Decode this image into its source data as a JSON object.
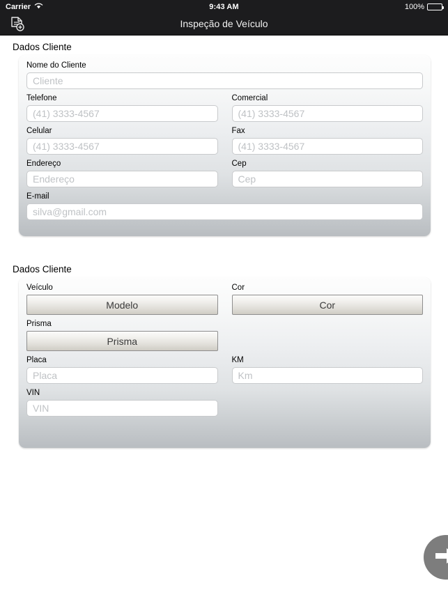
{
  "status_bar": {
    "carrier": "Carrier",
    "wifi_icon": "wifi-icon",
    "time": "9:43 AM",
    "battery_percent": "100%",
    "battery_icon": "battery-full-icon"
  },
  "nav_bar": {
    "title": "Inspeção de Veículo",
    "left_button_icon": "document-add-icon"
  },
  "sections": [
    {
      "title": "Dados Cliente",
      "rows": [
        [
          {
            "label": "Nome do Cliente",
            "placeholder": "Cliente",
            "value": "",
            "type": "text",
            "width": "full",
            "name": "client-name"
          }
        ],
        [
          {
            "label": "Telefone",
            "placeholder": "(41) 3333-4567",
            "value": "",
            "type": "text",
            "width": "half",
            "name": "phone"
          },
          {
            "label": "Comercial",
            "placeholder": "(41) 3333-4567",
            "value": "",
            "type": "text",
            "width": "half",
            "name": "commercial-phone"
          }
        ],
        [
          {
            "label": "Celular",
            "placeholder": "(41) 3333-4567",
            "value": "",
            "type": "text",
            "width": "half",
            "name": "mobile-phone"
          },
          {
            "label": "Fax",
            "placeholder": "(41) 3333-4567",
            "value": "",
            "type": "text",
            "width": "half",
            "name": "fax"
          }
        ],
        [
          {
            "label": "Endereço",
            "placeholder": "Endereço",
            "value": "",
            "type": "text",
            "width": "half",
            "name": "address"
          },
          {
            "label": "Cep",
            "placeholder": "Cep",
            "value": "",
            "type": "text",
            "width": "half",
            "name": "postal-code"
          }
        ],
        [
          {
            "label": "E-mail",
            "placeholder": "silva@gmail.com",
            "value": "",
            "type": "text",
            "width": "full",
            "name": "email"
          }
        ]
      ]
    },
    {
      "title": "Dados Cliente",
      "rows": [
        [
          {
            "label": "Veículo",
            "button_label": "Modelo",
            "type": "button",
            "width": "half",
            "name": "vehicle-model"
          },
          {
            "label": "Cor",
            "button_label": "Cor",
            "type": "button",
            "width": "half",
            "name": "vehicle-color"
          }
        ],
        [
          {
            "label": "Prisma",
            "button_label": "Prisma",
            "type": "button",
            "width": "half",
            "name": "vehicle-prisma"
          },
          {
            "label": "",
            "type": "empty",
            "width": "half",
            "name": "empty-slot"
          }
        ],
        [
          {
            "label": "Placa",
            "placeholder": "Placa",
            "value": "",
            "type": "text",
            "width": "half",
            "name": "license-plate"
          },
          {
            "label": "KM",
            "placeholder": "Km",
            "value": "",
            "type": "text",
            "width": "half",
            "name": "odometer"
          }
        ],
        [
          {
            "label": "VIN",
            "placeholder": "VIN",
            "value": "",
            "type": "text",
            "width": "half",
            "name": "vin"
          },
          {
            "label": "",
            "type": "empty",
            "width": "half",
            "name": "empty-slot"
          }
        ]
      ]
    }
  ],
  "fab": {
    "icon": "arrow-right-icon",
    "color": "#7d7d7d"
  }
}
